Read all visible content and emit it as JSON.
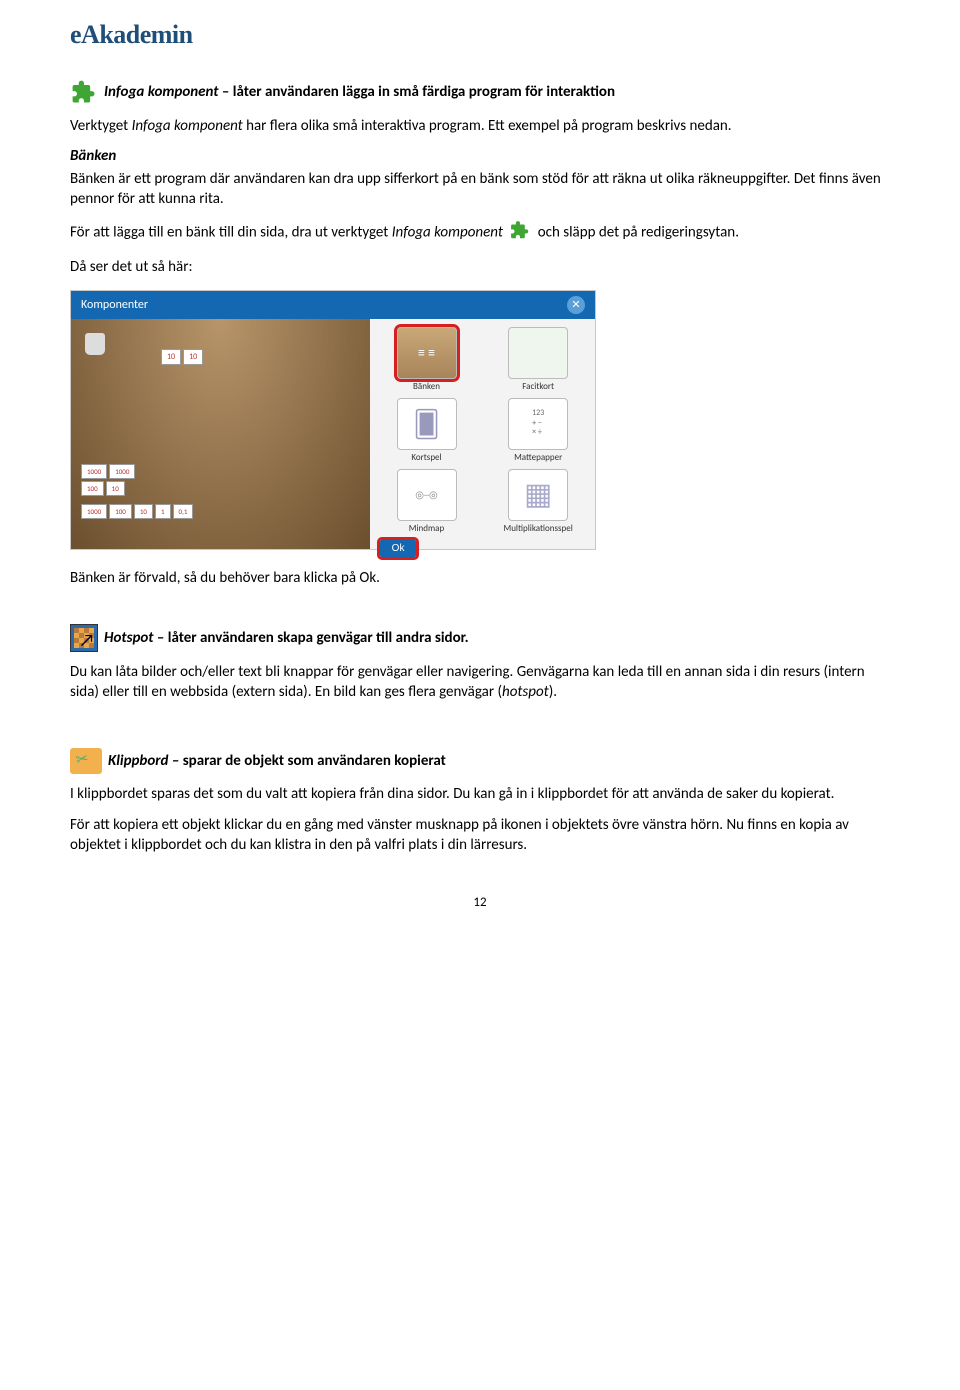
{
  "logo": "eAkademin",
  "section1": {
    "title_strong": "Infoga komponent",
    "title_rest": " – låter användaren lägga in små färdiga program för interaktion",
    "p1_a": "Verktyget ",
    "p1_em": "Infoga komponent",
    "p1_b": " har flera olika små interaktiva program. Ett exempel på program beskrivs nedan.",
    "banken_head": "Bänken",
    "banken_body": "Bänken är ett program där användaren kan dra upp sifferkort på en bänk som stöd för att räkna ut olika räkneuppgifter. Det finns även pennor för att kunna rita.",
    "drag_a": "För att lägga till en bänk till din sida, dra ut verktyget ",
    "drag_em": "Infoga komponent",
    "drag_b": " och släpp det på redigeringsytan.",
    "then": "Då ser det ut så här:",
    "after": "Bänken är förvald, så du behöver bara klicka på Ok."
  },
  "komponenter": {
    "header": "Komponenter",
    "items": [
      "Bänken",
      "Facitkort",
      "Kortspel",
      "Mattepapper",
      "Mindmap",
      "Multiplikationsspel"
    ],
    "ok": "Ok",
    "cards_left": [
      "1000",
      "100",
      "10",
      "1",
      "0,1"
    ],
    "cards_left2": [
      "1000",
      "100",
      "1000",
      "10"
    ],
    "cards_top": [
      "10",
      "10"
    ]
  },
  "section2": {
    "title_strong": "Hotspot",
    "title_rest": " – låter användaren skapa genvägar till andra sidor.",
    "p1": "Du kan låta bilder och/eller text bli knappar för genvägar eller navigering. Genvägarna kan leda till en annan sida i din resurs (intern sida) eller till en webbsida (extern sida). En bild kan ges flera genvägar (",
    "p1_em": "hotspot",
    "p1_b": ")."
  },
  "section3": {
    "title_strong": "Klippbord",
    "title_rest": " – sparar de objekt som användaren kopierat",
    "p1": "I klippbordet sparas det som du valt att kopiera från dina sidor. Du kan gå in i klippbordet för att använda de saker du kopierat.",
    "p2": "För att kopiera ett objekt klickar du en gång med vänster musknapp på ikonen i objektets övre vänstra hörn. Nu finns en kopia av objektet i klippbordet och du kan klistra in den på valfri plats i din lärresurs."
  },
  "page": "12"
}
